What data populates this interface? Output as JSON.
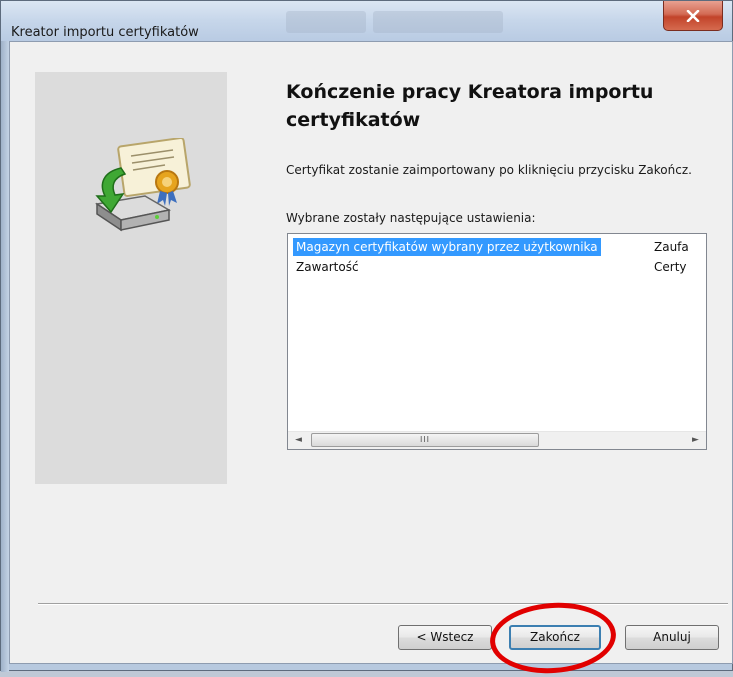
{
  "window": {
    "title": "Kreator importu certyfikatów",
    "close_symbol": "x"
  },
  "wizard": {
    "heading": "Kończenie pracy Kreatora importu certyfikatów",
    "description": "Certyfikat zostanie zaimportowany po kliknięciu przycisku Zakończ.",
    "settings_label": "Wybrane zostały następujące ustawienia:",
    "icon": "certificate-import-icon"
  },
  "settings_list": [
    {
      "name": "Magazyn certyfikatów wybrany przez użytkownika",
      "value": "Zaufa",
      "selected": true
    },
    {
      "name": "Zawartość",
      "value": "Certy",
      "selected": false
    }
  ],
  "scrollbar": {
    "left_arrow": "◄",
    "right_arrow": "►",
    "thumb_grip": "III"
  },
  "buttons": {
    "back": "< Wstecz",
    "finish": "Zakończ",
    "cancel": "Anuluj"
  },
  "colors": {
    "selection": "#3399ff",
    "annotation_circle": "#e10000",
    "close_button": "#c2432a"
  }
}
